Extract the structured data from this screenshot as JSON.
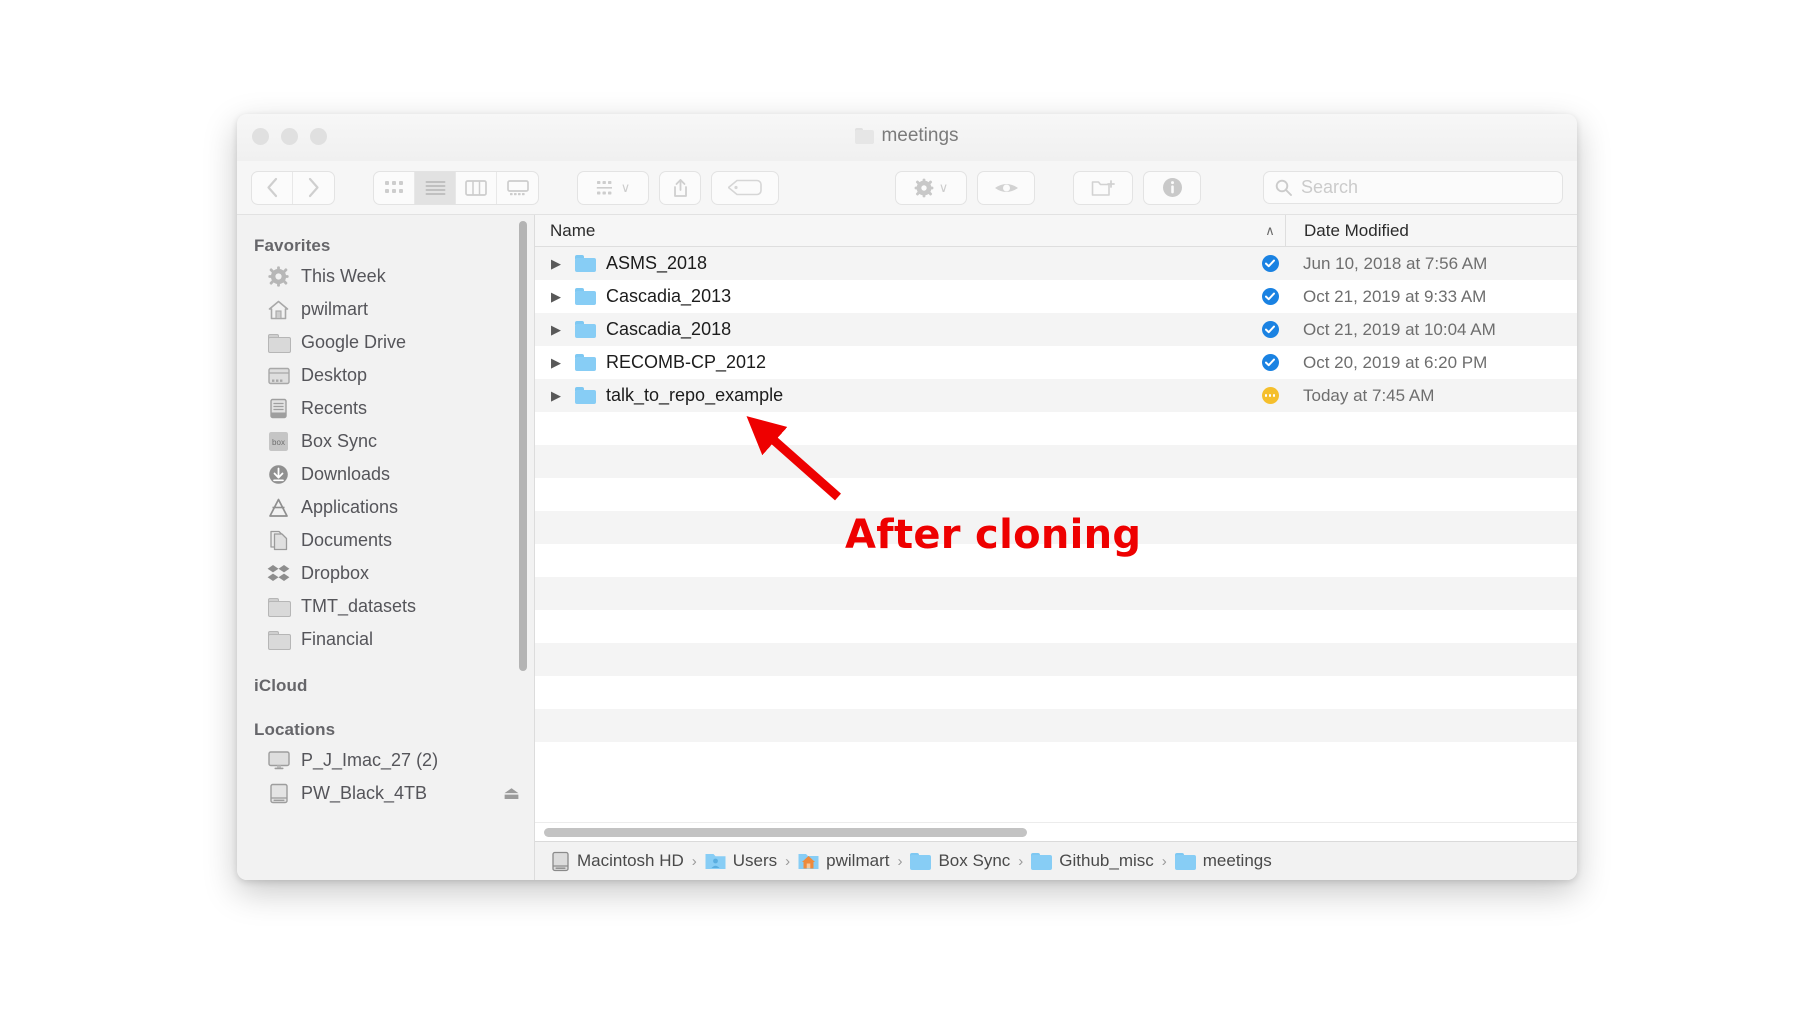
{
  "window": {
    "title": "meetings",
    "title_icon": "folder-icon",
    "traffic_lights": [
      "close-button",
      "minimize-button",
      "zoom-button"
    ]
  },
  "toolbar": {
    "back_label": "‹",
    "forward_label": "›",
    "view_modes": [
      {
        "name": "icon-view",
        "icon": "grid-icon",
        "active": false
      },
      {
        "name": "list-view",
        "icon": "list-icon",
        "active": true
      },
      {
        "name": "column-view",
        "icon": "columns-icon",
        "active": false
      },
      {
        "name": "gallery-view",
        "icon": "gallery-icon",
        "active": false
      }
    ],
    "group_button": {
      "icon": "group-icon",
      "chevron": "∨"
    },
    "share_button": {
      "icon": "share-icon"
    },
    "tag_button": {
      "icon": "tag-icon"
    },
    "action_button": {
      "icon": "gear-icon",
      "chevron": "∨"
    },
    "quicklook_button": {
      "icon": "eye-icon"
    },
    "new_folder_button": {
      "icon": "new-folder-icon"
    },
    "info_button": {
      "icon": "info-icon"
    },
    "search": {
      "placeholder": "Search",
      "value": "",
      "icon": "search-icon"
    }
  },
  "sidebar": {
    "sections": [
      {
        "heading": "Favorites",
        "items": [
          {
            "label": "This Week",
            "icon": "gear-icon"
          },
          {
            "label": "pwilmart",
            "icon": "home-icon"
          },
          {
            "label": "Google Drive",
            "icon": "folder-icon"
          },
          {
            "label": "Desktop",
            "icon": "desktop-icon"
          },
          {
            "label": "Recents",
            "icon": "recents-icon"
          },
          {
            "label": "Box Sync",
            "icon": "box-icon"
          },
          {
            "label": "Downloads",
            "icon": "downloads-icon"
          },
          {
            "label": "Applications",
            "icon": "applications-icon"
          },
          {
            "label": "Documents",
            "icon": "documents-icon"
          },
          {
            "label": "Dropbox",
            "icon": "dropbox-icon"
          },
          {
            "label": "TMT_datasets",
            "icon": "folder-icon"
          },
          {
            "label": "Financial",
            "icon": "folder-icon"
          }
        ]
      },
      {
        "heading": "iCloud",
        "items": []
      },
      {
        "heading": "Locations",
        "items": [
          {
            "label": "P_J_Imac_27 (2)",
            "icon": "imac-icon"
          },
          {
            "label": "PW_Black_4TB",
            "icon": "external-drive-icon",
            "eject": "⏏"
          }
        ]
      }
    ]
  },
  "file_list": {
    "columns": [
      {
        "key": "name",
        "label": "Name",
        "sorted": true,
        "sort_arrow": "∧"
      },
      {
        "key": "date",
        "label": "Date Modified"
      }
    ],
    "rows": [
      {
        "name": "ASMS_2018",
        "icon": "folder-icon",
        "disclosure": "▶",
        "badge": "synced",
        "date": "Jun 10, 2018 at 7:56 AM"
      },
      {
        "name": "Cascadia_2013",
        "icon": "folder-icon",
        "disclosure": "▶",
        "badge": "synced",
        "date": "Oct 21, 2019 at 9:33 AM"
      },
      {
        "name": "Cascadia_2018",
        "icon": "folder-icon",
        "disclosure": "▶",
        "badge": "synced",
        "date": "Oct 21, 2019 at 10:04 AM"
      },
      {
        "name": "RECOMB-CP_2012",
        "icon": "folder-icon",
        "disclosure": "▶",
        "badge": "synced",
        "date": "Oct 20, 2019 at 6:20 PM"
      },
      {
        "name": "talk_to_repo_example",
        "icon": "folder-icon",
        "disclosure": "▶",
        "badge": "pending",
        "date": "Today at 7:45 AM"
      }
    ],
    "empty_row_count": 11
  },
  "path_bar": {
    "crumbs": [
      {
        "label": "Macintosh HD",
        "icon": "hard-drive-icon"
      },
      {
        "label": "Users",
        "icon": "users-folder-icon"
      },
      {
        "label": "pwilmart",
        "icon": "home-folder-icon"
      },
      {
        "label": "Box Sync",
        "icon": "folder-icon"
      },
      {
        "label": "Github_misc",
        "icon": "folder-icon"
      },
      {
        "label": "meetings",
        "icon": "folder-icon"
      }
    ],
    "separator": "›"
  },
  "annotation": {
    "label": "After cloning",
    "color": "#ee0000",
    "arrow": "red-arrow-icon"
  },
  "colors": {
    "accent_sync": "#1a82e2",
    "accent_pending": "#f5bf2c",
    "folder_blue": "#87cdf5",
    "annotation_red": "#ee0000"
  }
}
